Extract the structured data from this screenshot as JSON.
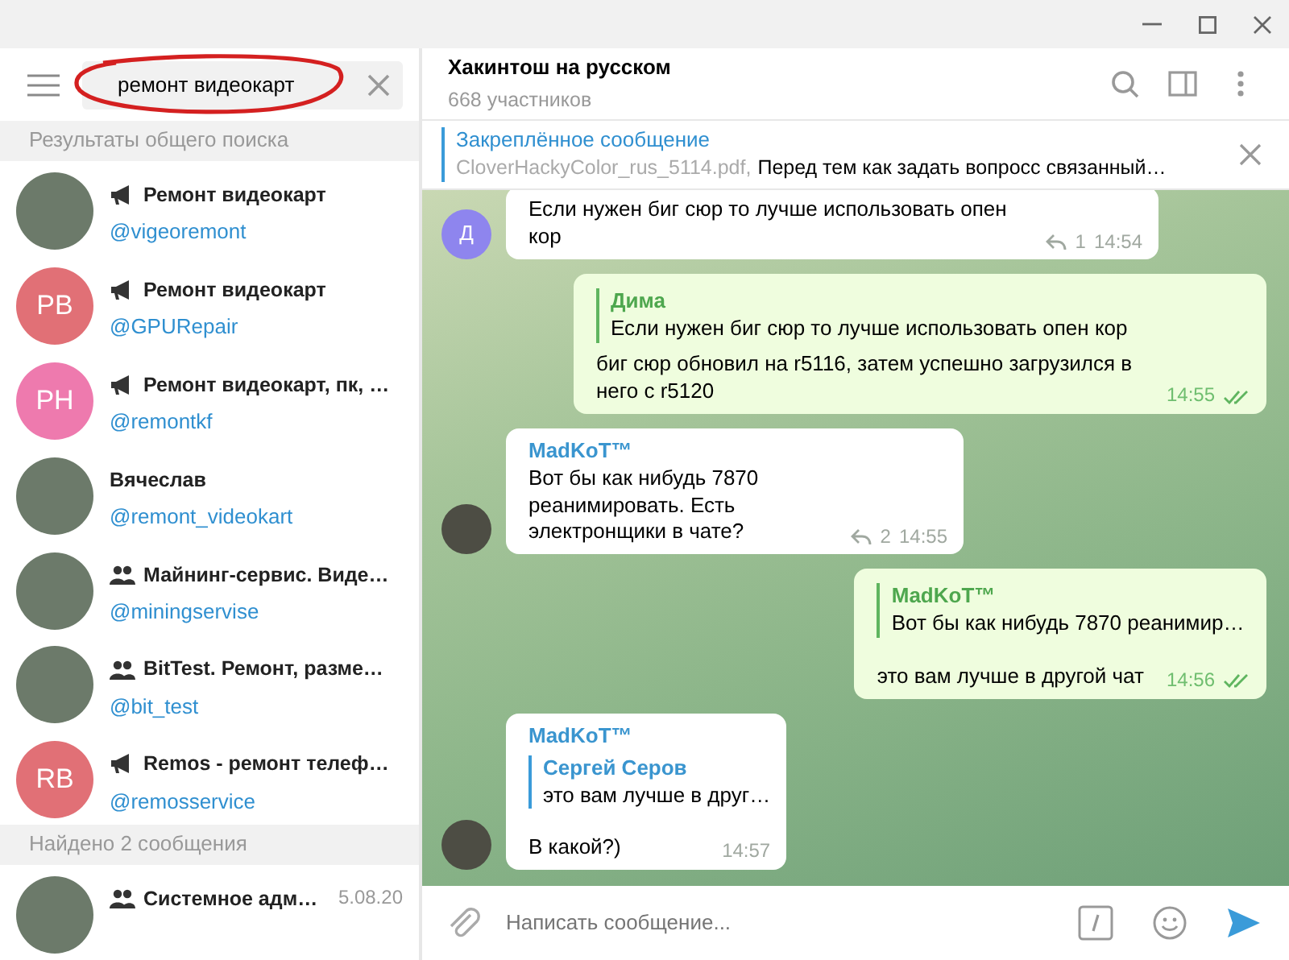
{
  "search": {
    "value": "ремонт видеокарт"
  },
  "sections": [
    {
      "title": "Результаты общего поиска",
      "results": [
        {
          "name": "Ремонт видеокарт",
          "username": "@vigeoremont",
          "kind": "channel",
          "avatar": {
            "kind": "photo"
          }
        },
        {
          "name": "Ремонт видеокарт",
          "username": "@GPURepair",
          "kind": "channel",
          "avatar": {
            "kind": "initials",
            "text": "PB",
            "color": "#e17076"
          }
        },
        {
          "name": "Ремонт видеокарт, пк, …",
          "username": "@remontkf",
          "kind": "channel",
          "avatar": {
            "kind": "initials",
            "text": "PH",
            "color": "#ee7aae"
          }
        },
        {
          "name": "Вячеслав",
          "username": "@remont_videokart",
          "kind": "user",
          "avatar": {
            "kind": "photo"
          }
        },
        {
          "name": "Майнинг-сервис. Виде…",
          "username": "@miningservise",
          "kind": "group",
          "avatar": {
            "kind": "photo"
          }
        },
        {
          "name": "BitTest. Ремонт, разме…",
          "username": "@bit_test",
          "kind": "group",
          "avatar": {
            "kind": "photo"
          }
        },
        {
          "name": "Remos - ремонт телеф…",
          "username": "@remosservice",
          "kind": "channel",
          "avatar": {
            "kind": "initials",
            "text": "RB",
            "color": "#e17076"
          }
        }
      ]
    },
    {
      "title": "Найдено 2 сообщения",
      "results": [
        {
          "name": "Системное адм…",
          "date": "5.08.20",
          "kind": "group",
          "avatar": {
            "kind": "photo"
          }
        }
      ]
    }
  ],
  "chat": {
    "title": "Хакинтош на русском",
    "subtitle": "668 участников"
  },
  "pinned": {
    "label": "Закреплённое сообщение",
    "file": "CloverHackyColor_rus_5114.pdf,",
    "text": "Перед тем как задать вопросс связанный…"
  },
  "messages": [
    {
      "kind": "incoming",
      "avatar": {
        "kind": "initials",
        "text": "Д",
        "color": "#8e85ee"
      },
      "text": "Если нужен биг сюр то лучше использовать опен кор",
      "replies": "1",
      "time": "14:54"
    },
    {
      "kind": "outgoing",
      "reply_to": {
        "author": "Дима",
        "text": "Если нужен биг сюр то лучше использовать опен кор"
      },
      "text": "биг сюр обновил на r5116, затем успешно загрузился в него с r5120",
      "time": "14:55"
    },
    {
      "kind": "incoming",
      "author": "MadKoT™",
      "avatar": {
        "kind": "photo"
      },
      "text": "Вот бы как нибудь 7870 реанимировать. Есть электронщики в чате?",
      "replies": "2",
      "time": "14:55"
    },
    {
      "kind": "outgoing",
      "reply_to": {
        "author": "MadKoT™",
        "text": "Вот бы как нибудь 7870 реанимир…"
      },
      "text": "это вам лучше в другой чат",
      "time": "14:56"
    },
    {
      "kind": "incoming",
      "author": "MadKoT™",
      "avatar": {
        "kind": "photo"
      },
      "reply_to": {
        "author": "Сергей Серов",
        "text": "это вам лучше в друг…"
      },
      "text": "В какой?)",
      "time": "14:57"
    }
  ],
  "composer": {
    "placeholder": "Написать сообщение..."
  }
}
